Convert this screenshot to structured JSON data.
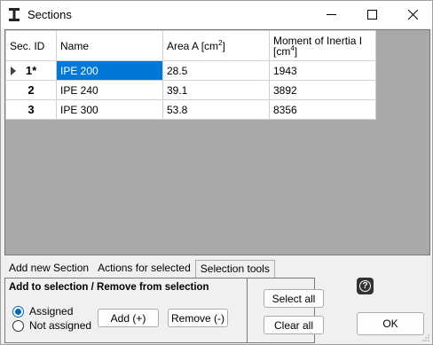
{
  "window": {
    "title": "Sections",
    "app_icon": "ibeam-section-icon"
  },
  "grid": {
    "columns": [
      "Sec. ID",
      "Name",
      "Area A [cm²]",
      "Moment of Inertia I [cm⁴]"
    ],
    "column_parts": {
      "area_prefix": "Area A [cm",
      "area_sup": "2",
      "area_suffix": "]",
      "moi_prefix": "Moment of Inertia I [cm",
      "moi_sup": "4",
      "moi_suffix": "]"
    },
    "rows": [
      {
        "id": "1*",
        "name": "IPE 200",
        "area": "28.5",
        "inertia": "1943",
        "current": true,
        "name_selected": true
      },
      {
        "id": "2",
        "name": "IPE 240",
        "area": "39.1",
        "inertia": "3892",
        "current": false,
        "name_selected": false
      },
      {
        "id": "3",
        "name": "IPE 300",
        "area": "53.8",
        "inertia": "8356",
        "current": false,
        "name_selected": false
      }
    ]
  },
  "tabs": [
    {
      "label": "Add new Section",
      "active": false
    },
    {
      "label": "Actions for selected",
      "active": false
    },
    {
      "label": "Selection tools",
      "active": true
    }
  ],
  "selection_panel": {
    "group_title": "Add to selection / Remove from selection",
    "radio_assigned": "Assigned",
    "radio_not_assigned": "Not assigned",
    "selected_radio": "Assigned",
    "add_label": "Add (+)",
    "remove_label": "Remove (-)",
    "select_all_label": "Select all",
    "clear_all_label": "Clear all"
  },
  "footer": {
    "ok_label": "OK",
    "help_icon": "help-icon"
  },
  "colors": {
    "selection": "#0078d7",
    "grid_background": "#a9a9a9",
    "radio_accent": "#0067c0"
  }
}
